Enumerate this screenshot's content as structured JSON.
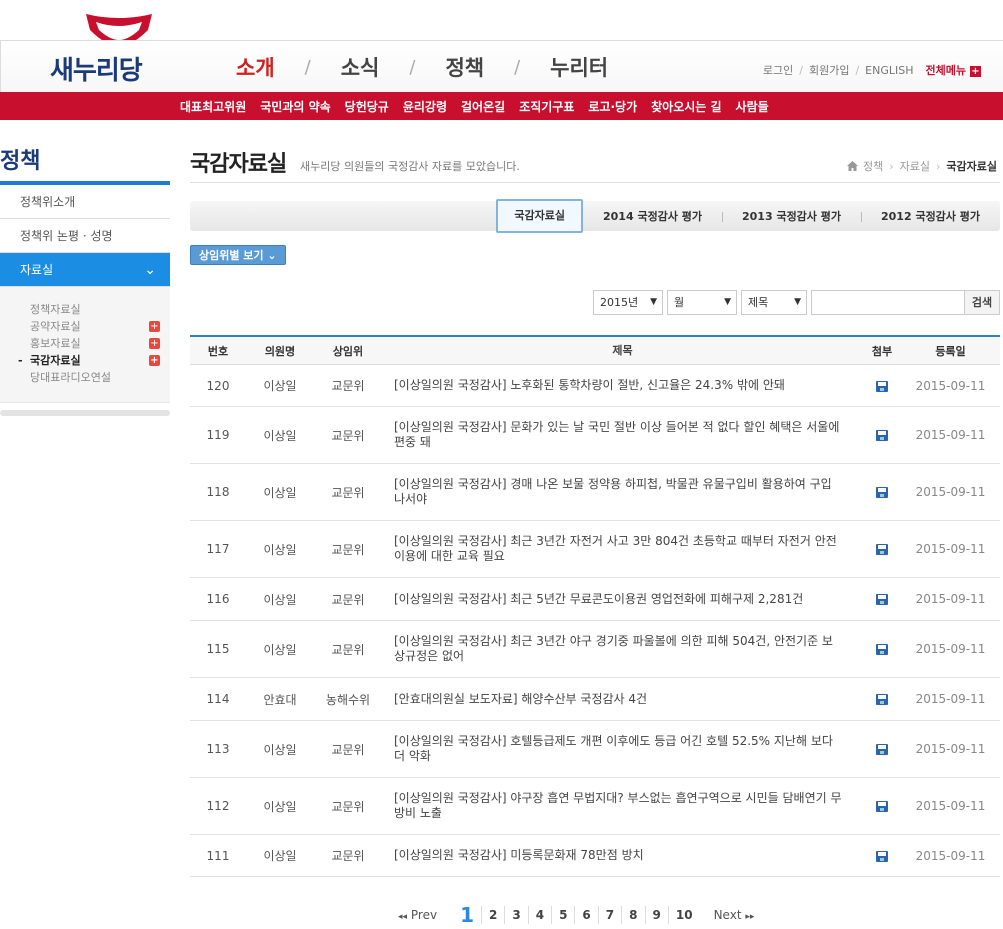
{
  "brand": {
    "name": "새누리당",
    "logo_icon": "smile-arc-logo"
  },
  "gnb": [
    {
      "label": "소개",
      "active": true
    },
    {
      "label": "소식"
    },
    {
      "label": "정책"
    },
    {
      "label": "누리터"
    }
  ],
  "gnb_separator": "/",
  "util": {
    "login": "로그인",
    "join": "회원가입",
    "english": "ENGLISH",
    "all_menu": "전체메뉴",
    "sep": "/"
  },
  "subnav": [
    "대표최고위원",
    "국민과의 약속",
    "당헌당규",
    "윤리강령",
    "걸어온길",
    "조직기구표",
    "로고·당가",
    "찾아오시는 길",
    "사람들"
  ],
  "lnb": {
    "title": "정책",
    "items": [
      "정책위소개",
      "정책위 논평 · 성명",
      "자료실"
    ],
    "sub_items": [
      "정책자료실",
      "공약자료실",
      "홍보자료실",
      "국감자료실",
      "당대표라디오연설"
    ]
  },
  "page": {
    "title": "국감자료실",
    "desc": "새누리당 의원들의 국정감사 자료를 모았습니다.",
    "breadcrumb": [
      "정책",
      "자료실",
      "국감자료실"
    ]
  },
  "tabs": [
    "국감자료실",
    "2014 국정감사 평가",
    "2013 국정감사 평가",
    "2012 국정감사 평가"
  ],
  "filter_button": "상임위별 보기",
  "search": {
    "year": "2015년",
    "month": "월",
    "field": "제목",
    "button": "검색"
  },
  "table": {
    "headers": [
      "번호",
      "의원명",
      "상임위",
      "제목",
      "첨부",
      "등록일"
    ],
    "rows": [
      {
        "no": "120",
        "member": "이상일",
        "committee": "교문위",
        "title": "[이상일의원 국정감사] 노후화된 통학차량이 절반, 신고율은 24.3% 밖에 안돼",
        "date": "2015-09-11",
        "h": 42
      },
      {
        "no": "119",
        "member": "이상일",
        "committee": "교문위",
        "title": "[이상일의원 국정감사] 문화가 있는 날 국민 절반 이상 들어본 적 없다 할인 혜택은 서울에 편중 돼",
        "date": "2015-09-11",
        "h": 57
      },
      {
        "no": "118",
        "member": "이상일",
        "committee": "교문위",
        "title": "[이상일의원 국정감사] 경매 나온 보물 정약용 하피첩, 박물관 유물구입비 활용하여 구입 나서야",
        "date": "2015-09-11",
        "h": 57
      },
      {
        "no": "117",
        "member": "이상일",
        "committee": "교문위",
        "title": "[이상일의원 국정감사] 최근 3년간 자전거 사고 3만 804건 초등학교 때부터 자전거 안전이용에 대한 교육 필요",
        "date": "2015-09-11",
        "h": 57
      },
      {
        "no": "116",
        "member": "이상일",
        "committee": "교문위",
        "title": "[이상일의원 국정감사] 최근 5년간 무료콘도이용권 영업전화에 피해구제 2,281건",
        "date": "2015-09-11",
        "h": 43
      },
      {
        "no": "115",
        "member": "이상일",
        "committee": "교문위",
        "title": "[이상일의원 국정감사] 최근 3년간 야구 경기중 파울볼에 의한 피해 504건, 안전기준 보상규정은 없어",
        "date": "2015-09-11",
        "h": 57
      },
      {
        "no": "114",
        "member": "안효대",
        "committee": "농해수위",
        "title": "[안효대의원실 보도자료] 해양수산부 국정감사 4건",
        "date": "2015-09-11",
        "h": 43
      },
      {
        "no": "113",
        "member": "이상일",
        "committee": "교문위",
        "title": "[이상일의원 국정감사] 호텔등급제도 개편 이후에도 등급 어긴 호텔 52.5% 지난해 보다 더 악화",
        "date": "2015-09-11",
        "h": 57
      },
      {
        "no": "112",
        "member": "이상일",
        "committee": "교문위",
        "title": "[이상일의원 국정감사] 야구장 흡연 무법지대? 부스없는 흡연구역으로 시민들 담배연기 무방비 노출",
        "date": "2015-09-11",
        "h": 57
      },
      {
        "no": "111",
        "member": "이상일",
        "committee": "교문위",
        "title": "[이상일의원 국정감사] 미등록문화재 78만점 방치",
        "date": "2015-09-11",
        "h": 42
      }
    ]
  },
  "pager": {
    "prev": "Prev",
    "next": "Next",
    "pages": [
      "1",
      "2",
      "3",
      "4",
      "5",
      "6",
      "7",
      "8",
      "9",
      "10"
    ],
    "current": "1"
  }
}
